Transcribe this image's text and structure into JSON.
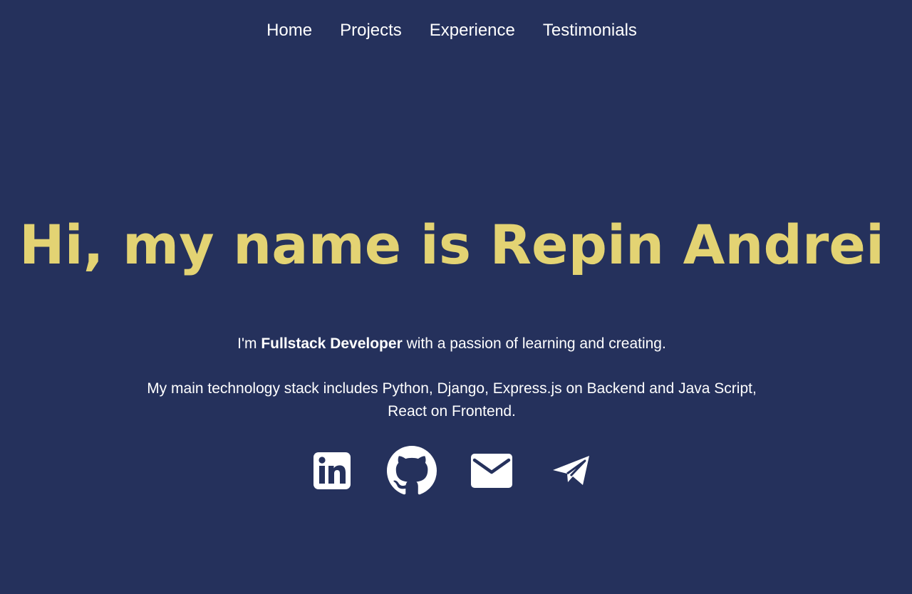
{
  "nav": {
    "items": [
      "Home",
      "Projects",
      "Experience",
      "Testimonials"
    ]
  },
  "hero": {
    "title": "Hi, my name is Repin Andrei",
    "intro_prefix": "I'm ",
    "intro_role": "Fullstack Developer",
    "intro_suffix": " with a passion of learning and creating.",
    "stack_text": "My main technology stack includes Python, Django, Express.js on Backend and Java Script, React on Frontend."
  },
  "socials": [
    {
      "icon": "linkedin-icon"
    },
    {
      "icon": "github-icon"
    },
    {
      "icon": "mail-icon"
    },
    {
      "icon": "telegram-icon"
    }
  ],
  "colors": {
    "background": "#25315c",
    "title": "#e3d373",
    "text": "#ffffff"
  }
}
